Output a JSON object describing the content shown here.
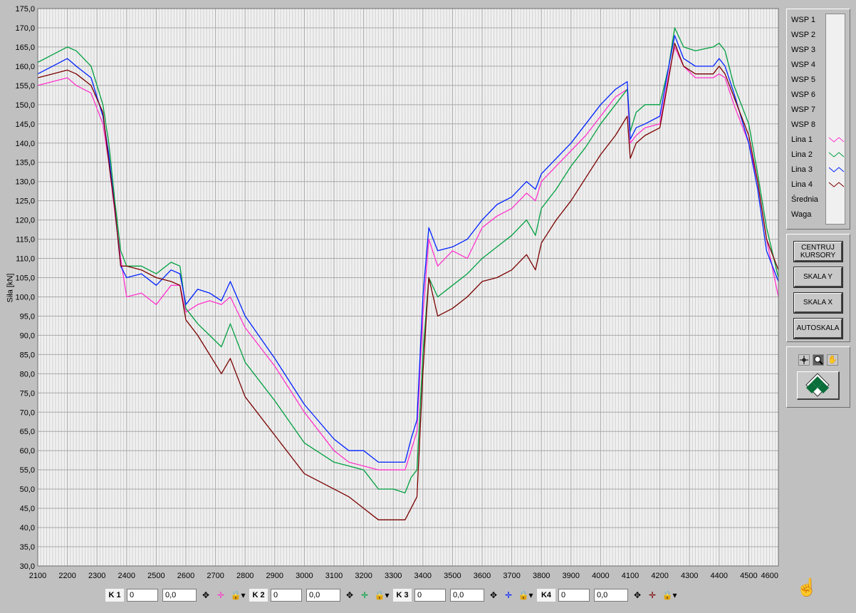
{
  "chart_data": {
    "type": "line",
    "ylabel": "Siła [kN]",
    "xlim": [
      2100,
      4600
    ],
    "ylim": [
      30,
      175
    ],
    "x_ticks": [
      "2100",
      "2200",
      "2300",
      "2400",
      "2500",
      "2600",
      "2700",
      "2800",
      "2900",
      "3000",
      "3100",
      "3200",
      "3300",
      "3400",
      "3500",
      "3600",
      "3700",
      "3800",
      "3900",
      "4000",
      "4100",
      "4200",
      "4300",
      "4400",
      "4500",
      "4600"
    ],
    "y_ticks": [
      "30,0",
      "35,0",
      "40,0",
      "45,0",
      "50,0",
      "55,0",
      "60,0",
      "65,0",
      "70,0",
      "75,0",
      "80,0",
      "85,0",
      "90,0",
      "95,0",
      "100,0",
      "105,0",
      "110,0",
      "115,0",
      "120,0",
      "125,0",
      "130,0",
      "135,0",
      "140,0",
      "145,0",
      "150,0",
      "155,0",
      "160,0",
      "165,0",
      "170,0",
      "175,0"
    ],
    "grid": true,
    "series": [
      {
        "name": "Lina 1",
        "color": "#ff33cc",
        "x": [
          2100,
          2150,
          2200,
          2230,
          2280,
          2320,
          2340,
          2360,
          2380,
          2400,
          2450,
          2500,
          2550,
          2580,
          2600,
          2640,
          2680,
          2720,
          2750,
          2800,
          2900,
          3000,
          3100,
          3150,
          3200,
          3250,
          3300,
          3340,
          3360,
          3380,
          3400,
          3420,
          3450,
          3500,
          3550,
          3600,
          3650,
          3700,
          3750,
          3780,
          3800,
          3850,
          3900,
          3950,
          4000,
          4050,
          4090,
          4100,
          4120,
          4150,
          4200,
          4230,
          4250,
          4280,
          4320,
          4380,
          4400,
          4420,
          4450,
          4500,
          4530,
          4560,
          4600
        ],
        "y": [
          155,
          156,
          157,
          155,
          153,
          145,
          135,
          122,
          110,
          100,
          101,
          98,
          103,
          103,
          96,
          98,
          99,
          98,
          100,
          92,
          82,
          70,
          60,
          57,
          56,
          55,
          55,
          55,
          60,
          65,
          95,
          115,
          108,
          112,
          110,
          118,
          121,
          123,
          127,
          125,
          130,
          134,
          138,
          142,
          147,
          152,
          154,
          140,
          142,
          144,
          145,
          158,
          165,
          160,
          157,
          157,
          158,
          157,
          150,
          140,
          130,
          115,
          100
        ]
      },
      {
        "name": "Lina 2",
        "color": "#00a040",
        "x": [
          2100,
          2150,
          2200,
          2230,
          2280,
          2320,
          2340,
          2360,
          2380,
          2400,
          2450,
          2500,
          2550,
          2580,
          2600,
          2640,
          2680,
          2720,
          2750,
          2800,
          2900,
          3000,
          3100,
          3150,
          3200,
          3250,
          3300,
          3340,
          3360,
          3380,
          3400,
          3420,
          3450,
          3500,
          3550,
          3600,
          3650,
          3700,
          3750,
          3780,
          3800,
          3850,
          3900,
          3950,
          4000,
          4050,
          4090,
          4100,
          4120,
          4150,
          4200,
          4230,
          4250,
          4280,
          4320,
          4380,
          4400,
          4420,
          4450,
          4500,
          4530,
          4560,
          4600
        ],
        "y": [
          161,
          163,
          165,
          164,
          160,
          150,
          140,
          125,
          112,
          108,
          108,
          106,
          109,
          108,
          97,
          93,
          90,
          87,
          93,
          83,
          73,
          62,
          57,
          56,
          55,
          50,
          50,
          49,
          53,
          55,
          85,
          105,
          100,
          103,
          106,
          110,
          113,
          116,
          120,
          116,
          123,
          128,
          134,
          139,
          145,
          150,
          154,
          143,
          148,
          150,
          150,
          160,
          170,
          165,
          164,
          165,
          166,
          164,
          155,
          145,
          132,
          118,
          105
        ]
      },
      {
        "name": "Lina 3",
        "color": "#0022ff",
        "x": [
          2100,
          2150,
          2200,
          2230,
          2280,
          2320,
          2340,
          2360,
          2380,
          2400,
          2450,
          2500,
          2550,
          2580,
          2600,
          2640,
          2680,
          2720,
          2750,
          2800,
          2900,
          3000,
          3100,
          3150,
          3200,
          3250,
          3300,
          3340,
          3360,
          3380,
          3400,
          3420,
          3450,
          3500,
          3550,
          3600,
          3650,
          3700,
          3750,
          3780,
          3800,
          3850,
          3900,
          3950,
          4000,
          4050,
          4090,
          4100,
          4120,
          4150,
          4200,
          4230,
          4250,
          4280,
          4320,
          4380,
          4400,
          4420,
          4450,
          4500,
          4530,
          4560,
          4600
        ],
        "y": [
          158,
          160,
          162,
          160,
          157,
          147,
          137,
          123,
          108,
          105,
          106,
          103,
          107,
          106,
          98,
          102,
          101,
          99,
          104,
          95,
          84,
          72,
          63,
          60,
          60,
          57,
          57,
          57,
          63,
          68,
          100,
          118,
          112,
          113,
          115,
          120,
          124,
          126,
          130,
          128,
          132,
          136,
          140,
          145,
          150,
          154,
          156,
          141,
          144,
          145,
          147,
          160,
          168,
          162,
          160,
          160,
          162,
          160,
          153,
          140,
          128,
          112,
          104
        ]
      },
      {
        "name": "Lina 4",
        "color": "#7a0000",
        "x": [
          2100,
          2150,
          2200,
          2230,
          2280,
          2320,
          2340,
          2360,
          2380,
          2400,
          2450,
          2500,
          2550,
          2580,
          2600,
          2640,
          2680,
          2720,
          2750,
          2800,
          2900,
          3000,
          3100,
          3150,
          3200,
          3250,
          3300,
          3340,
          3360,
          3380,
          3400,
          3420,
          3450,
          3500,
          3550,
          3600,
          3650,
          3700,
          3750,
          3780,
          3800,
          3850,
          3900,
          3950,
          4000,
          4050,
          4090,
          4100,
          4120,
          4150,
          4200,
          4230,
          4250,
          4280,
          4320,
          4380,
          4400,
          4420,
          4450,
          4500,
          4530,
          4560,
          4600
        ],
        "y": [
          157,
          158,
          159,
          158,
          155,
          148,
          135,
          123,
          108,
          108,
          107,
          105,
          104,
          103,
          94,
          90,
          85,
          80,
          84,
          74,
          64,
          54,
          50,
          48,
          45,
          42,
          42,
          42,
          45,
          48,
          80,
          105,
          95,
          97,
          100,
          104,
          105,
          107,
          111,
          107,
          114,
          120,
          125,
          131,
          137,
          142,
          147,
          136,
          140,
          142,
          144,
          157,
          166,
          160,
          158,
          158,
          160,
          158,
          152,
          142,
          130,
          115,
          107
        ]
      }
    ]
  },
  "legend": {
    "items": [
      {
        "label": "WSP 1",
        "color": ""
      },
      {
        "label": "WSP 2",
        "color": ""
      },
      {
        "label": "WSP 3",
        "color": ""
      },
      {
        "label": "WSP 4",
        "color": ""
      },
      {
        "label": "WSP 5",
        "color": ""
      },
      {
        "label": "WSP 6",
        "color": ""
      },
      {
        "label": "WSP 7",
        "color": ""
      },
      {
        "label": "WSP 8",
        "color": ""
      },
      {
        "label": "Lina 1",
        "color": "#ff33cc"
      },
      {
        "label": "Lina 2",
        "color": "#00a040"
      },
      {
        "label": "Lina 3",
        "color": "#0022ff"
      },
      {
        "label": "Lina 4",
        "color": "#7a0000"
      },
      {
        "label": "Średnia",
        "color": ""
      },
      {
        "label": "Waga",
        "color": ""
      }
    ]
  },
  "buttons": {
    "center_cursors": "CENTRUJ KURSORY",
    "scale_y": "SKALA Y",
    "scale_x": "SKALA X",
    "autoscale": "AUTOSKALA"
  },
  "cursors": [
    {
      "label": "K 1",
      "index": "0",
      "value": "0,0",
      "color": "#ff33cc"
    },
    {
      "label": "K 2",
      "index": "0",
      "value": "0,0",
      "color": "#00a040"
    },
    {
      "label": "K 3",
      "index": "0",
      "value": "0,0",
      "color": "#0022ff"
    },
    {
      "label": "K4",
      "index": "0",
      "value": "0,0",
      "color": "#7a0000"
    }
  ]
}
